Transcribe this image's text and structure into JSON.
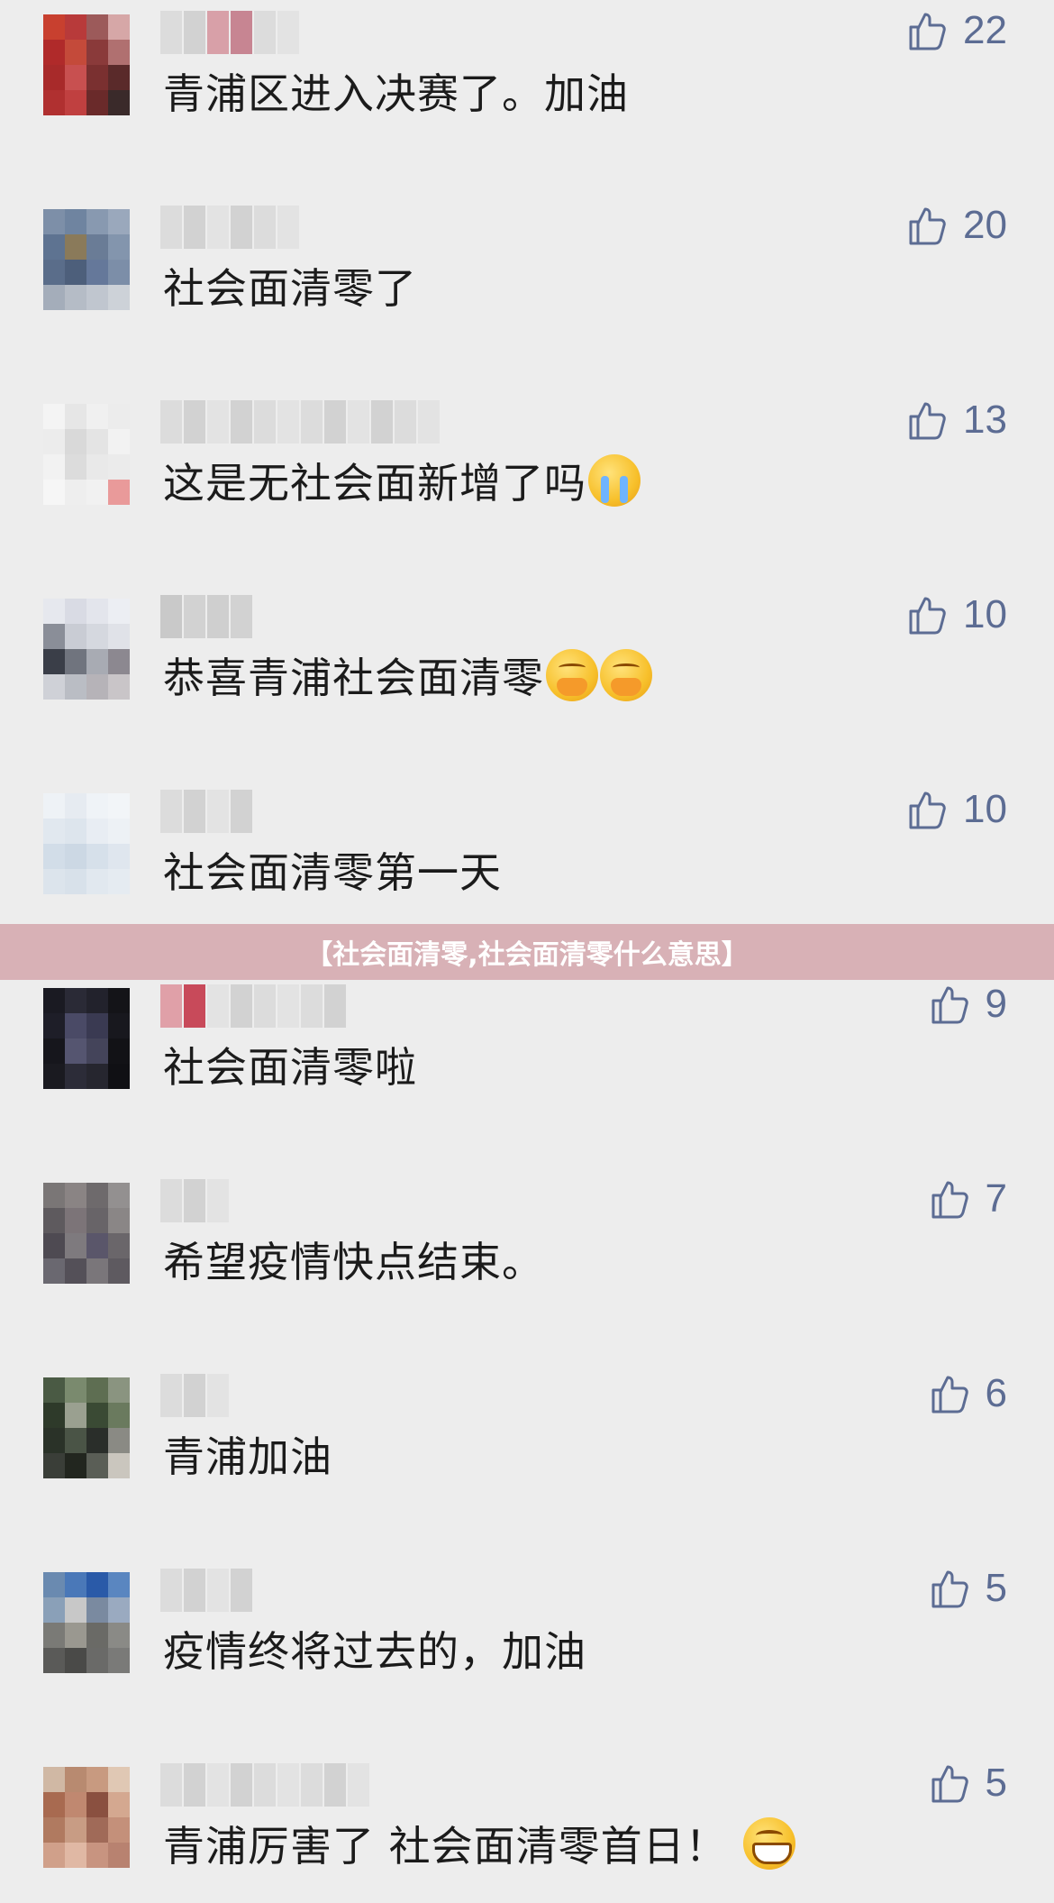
{
  "banner": {
    "title": "【社会面清零,社会面清零什么意思】"
  },
  "comments": [
    {
      "text": "青浦区进入决赛了。加油",
      "likes": "22",
      "emoji": []
    },
    {
      "text": "社会面清零了",
      "likes": "20",
      "emoji": []
    },
    {
      "text": "这是无社会面新增了吗",
      "likes": "13",
      "emoji": [
        "crying-face"
      ]
    },
    {
      "text": "恭喜青浦社会面清零",
      "likes": "10",
      "emoji": [
        "blush-hands-face",
        "blush-hands-face"
      ]
    },
    {
      "text": "社会面清零第一天",
      "likes": "10",
      "emoji": []
    },
    {
      "text": "社会面清零啦",
      "likes": "9",
      "emoji": []
    },
    {
      "text": "希望疫情快点结束。",
      "likes": "7",
      "emoji": []
    },
    {
      "text": "青浦加油",
      "likes": "6",
      "emoji": []
    },
    {
      "text": "疫情终将过去的，加油",
      "likes": "5",
      "emoji": []
    },
    {
      "text": "青浦厉害了 社会面清零首日！",
      "likes": "5",
      "emoji": [
        "grinning-face"
      ]
    }
  ],
  "colors": {
    "background": "#ededed",
    "like_icon": "#5c6c93",
    "banner": "#d8b1b6",
    "text": "#1b1b1b"
  }
}
